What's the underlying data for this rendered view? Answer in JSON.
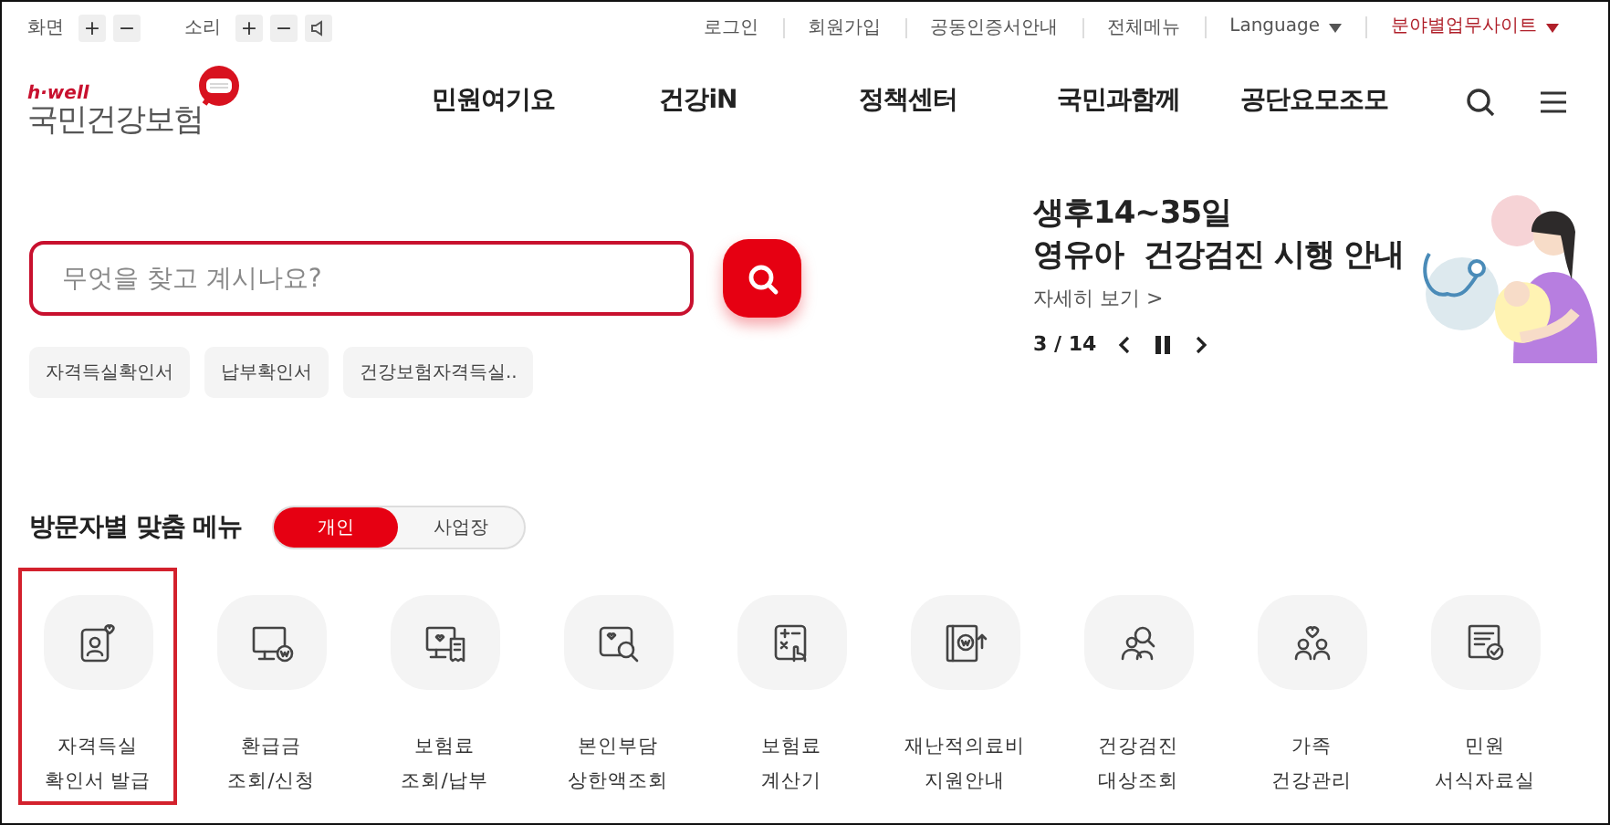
{
  "utility_bar": {
    "screen": {
      "label": "화면",
      "buttons": [
        "+",
        "−"
      ]
    },
    "sound": {
      "label": "소리",
      "buttons": [
        "+",
        "−"
      ]
    },
    "links": [
      {
        "label": "로그인",
        "kind": "link"
      },
      {
        "label": "회원가입",
        "kind": "link"
      },
      {
        "label": "공동인증서안내",
        "kind": "link"
      },
      {
        "label": "전체메뉴",
        "kind": "link"
      },
      {
        "label": "Language",
        "kind": "dropdown"
      },
      {
        "label": "분야별업무사이트",
        "kind": "dropdown-accent"
      }
    ]
  },
  "logo": {
    "tagline": "h·well",
    "name": "국민건강보험"
  },
  "nav": [
    "민원여기요",
    "건강iN",
    "정책센터",
    "국민과함께",
    "공단요모조모"
  ],
  "search": {
    "placeholder": "무엇을 찾고 계시나요?"
  },
  "quick_chips": [
    "자격득실확인서",
    "납부확인서",
    "건강보험자격득실.."
  ],
  "promo": {
    "title_lines": [
      "생후14~35일",
      "영유아  건강검진 시행 안내"
    ],
    "more": "자세히 보기 >",
    "counter": "3 / 14",
    "paused": false
  },
  "visitor_menu": {
    "title": "방문자별 맞춤 메뉴",
    "toggle": [
      {
        "label": "개인",
        "selected": true
      },
      {
        "label": "사업장",
        "selected": false
      }
    ],
    "items": [
      {
        "lines": [
          "자격득실",
          "확인서 발급"
        ],
        "highlighted": true
      },
      {
        "lines": [
          "환급금",
          "조회/신청"
        ],
        "highlighted": false
      },
      {
        "lines": [
          "보험료",
          "조회/납부"
        ],
        "highlighted": false
      },
      {
        "lines": [
          "본인부담",
          "상한액조회"
        ],
        "highlighted": false
      },
      {
        "lines": [
          "보험료",
          "계산기"
        ],
        "highlighted": false
      },
      {
        "lines": [
          "재난적의료비",
          "지원안내"
        ],
        "highlighted": false
      },
      {
        "lines": [
          "건강검진",
          "대상조회"
        ],
        "highlighted": false
      },
      {
        "lines": [
          "가족",
          "건강관리"
        ],
        "highlighted": false
      },
      {
        "lines": [
          "민원",
          "서식자료실"
        ],
        "highlighted": false
      }
    ]
  }
}
